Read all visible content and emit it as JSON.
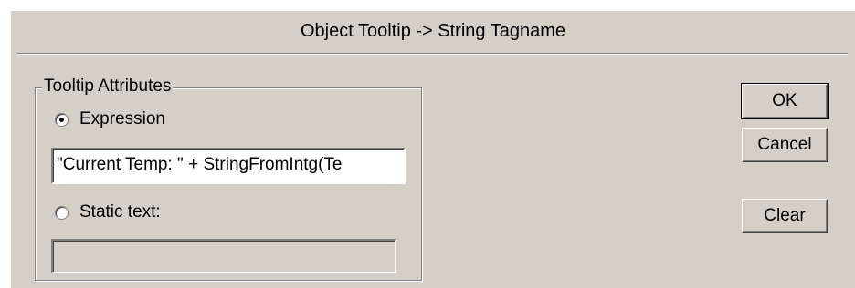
{
  "dialog": {
    "title": "Object Tooltip -> String Tagname"
  },
  "tooltip_attributes": {
    "group_label": "Tooltip Attributes",
    "expression": {
      "label": "Expression",
      "selected": true,
      "value": "\"Current Temp: \" + StringFromIntg(Te"
    },
    "static_text": {
      "label": "Static text:",
      "selected": false,
      "value": ""
    }
  },
  "buttons": {
    "ok": "OK",
    "cancel": "Cancel",
    "clear": "Clear"
  }
}
